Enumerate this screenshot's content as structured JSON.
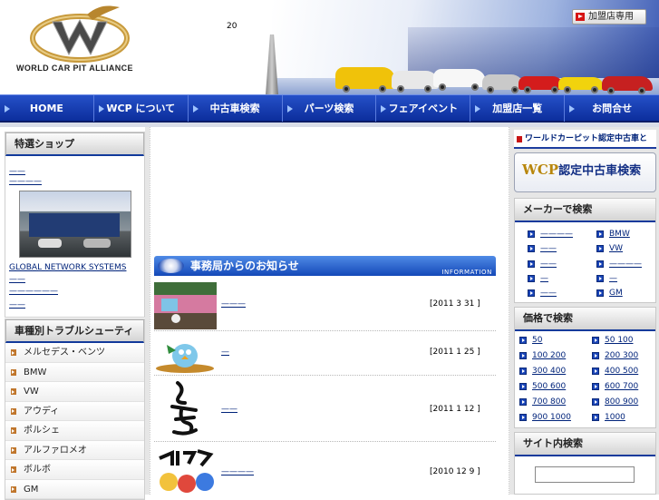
{
  "header": {
    "logo_text": "WORLD CAR PIT ALLIANCE",
    "number": "20",
    "member_button": "加盟店専用"
  },
  "nav": [
    {
      "label": "HOME"
    },
    {
      "label": "WCP について"
    },
    {
      "label": "中古車検索"
    },
    {
      "label": "パーツ検索"
    },
    {
      "label": "フェアイベント"
    },
    {
      "label": "加盟店一覧"
    },
    {
      "label": "お問合せ"
    }
  ],
  "featured": {
    "title": "特選ショップ",
    "link1": "——",
    "link2": "————",
    "shop_name": "GLOBAL NETWORK SYSTEMS",
    "link3": "——",
    "link4": "——————",
    "link5": "——"
  },
  "troubleshooting": {
    "title": "車種別トラブルシューティング",
    "items": [
      "メルセデス・ベンツ",
      "BMW",
      "VW",
      "アウディ",
      "ポルシェ",
      "アルファロメオ",
      "ボルボ",
      "GM"
    ]
  },
  "news": {
    "title": "事務局からのお知らせ",
    "label": "INFORMATION",
    "items": [
      {
        "link": "———",
        "date": "[2011 3 31 ]"
      },
      {
        "link": "—",
        "date": "[2011 1 25 ]"
      },
      {
        "link": "——",
        "date": "[2011 1 12 ]"
      },
      {
        "link": "————",
        "date": "[2010 12 9 ]"
      }
    ]
  },
  "right": {
    "wcp_link": "ワールドカーピット認定中古車とは?",
    "banner_prefix": "WCP",
    "banner_suffix": "認定中古車検索",
    "maker_title": "メーカーで検索",
    "makers_left": [
      "————",
      "——",
      "——",
      "—",
      "——"
    ],
    "makers_right": [
      "BMW",
      "VW",
      "————",
      "—",
      "GM"
    ],
    "price_title": "価格で検索",
    "prices_left": [
      "50",
      "100 200",
      "300 400",
      "500 600",
      "700 800",
      "900 1000"
    ],
    "prices_right": [
      "50 100",
      "200 300",
      "400 500",
      "600 700",
      "800 900",
      "1000"
    ],
    "site_search_title": "サイト内検索",
    "search_value": ""
  }
}
